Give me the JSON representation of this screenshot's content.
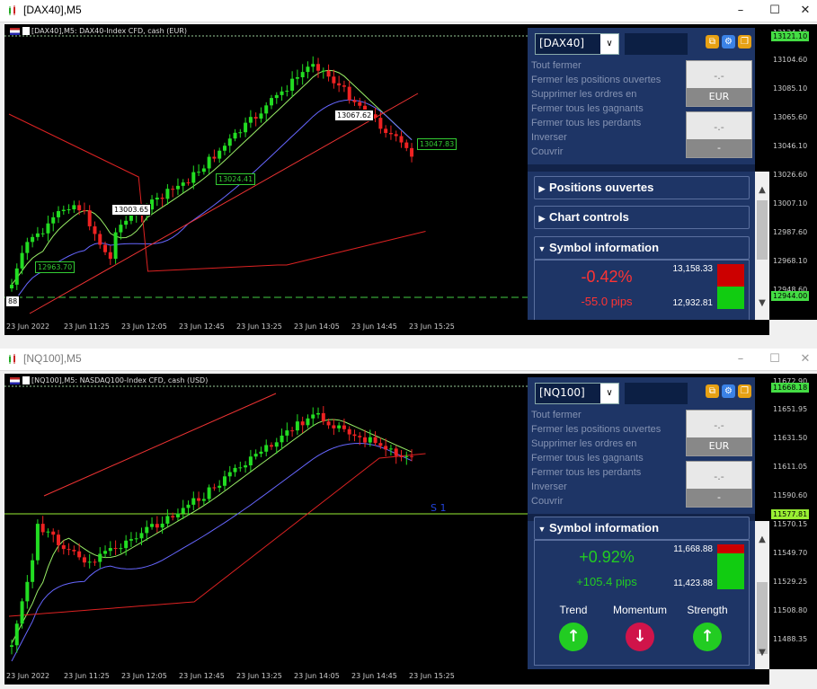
{
  "windows": [
    {
      "id": "dax",
      "title": "[DAX40],M5",
      "active": true,
      "header": "[DAX40],M5: DAX40-Index CFD, cash (EUR)",
      "price_labels": [
        "13124.10",
        "13104.60",
        "13085.10",
        "13065.60",
        "13046.10",
        "13026.60",
        "13007.10",
        "12987.60",
        "12968.10",
        "12948.60"
      ],
      "price_tags": [
        {
          "text": "13121.10",
          "bg": "#4d4",
          "fg": "#000"
        },
        {
          "text": "12944.00",
          "bg": "#4d4",
          "fg": "#000"
        }
      ],
      "time_labels": [
        "23 Jun 2022",
        "23 Jun 11:25",
        "23 Jun 12:05",
        "23 Jun 12:45",
        "23 Jun 13:25",
        "23 Jun 14:05",
        "23 Jun 14:45",
        "23 Jun 15:25"
      ],
      "annotations": [
        {
          "text": "13067.62",
          "style": "white"
        },
        {
          "text": "13047.83",
          "style": "green"
        },
        {
          "text": "13024.41",
          "style": "green"
        },
        {
          "text": "13003.65",
          "style": "white"
        },
        {
          "text": "12963.70",
          "style": "green"
        },
        {
          "text": "88",
          "style": "white"
        }
      ],
      "panel": {
        "symbol": "[DAX40]",
        "menu": [
          "Tout fermer",
          "Fermer les positions ouvertes",
          "Supprimer les ordres en",
          "Fermer tous les gagnants",
          "Fermer tous les perdants",
          "Inverser",
          "Couvrir"
        ],
        "box1": {
          "value": "-.-",
          "label": "EUR"
        },
        "box2": {
          "value": "-.-",
          "label": "-"
        },
        "sections": [
          "Positions ouvertes",
          "Chart controls",
          "Symbol information"
        ],
        "symbol_info": {
          "pct": "-0.42%",
          "pips": "-55.0 pips",
          "high": "13,158.33",
          "low": "12,932.81",
          "color": "#e42"
        }
      }
    },
    {
      "id": "nq",
      "title": "[NQ100],M5",
      "active": false,
      "header": "[NQ100],M5: NASDAQ100-Index CFD, cash (USD)",
      "price_labels": [
        "11672.90",
        "11651.95",
        "11631.50",
        "11611.05",
        "11590.60",
        "11570.15",
        "11549.70",
        "11529.25",
        "11508.80",
        "11488.35"
      ],
      "price_tags": [
        {
          "text": "11668.18",
          "bg": "#4d4",
          "fg": "#000"
        },
        {
          "text": "11577.81",
          "bg": "#9e3",
          "fg": "#000"
        }
      ],
      "time_labels": [
        "23 Jun 2022",
        "23 Jun 11:25",
        "23 Jun 12:05",
        "23 Jun 12:45",
        "23 Jun 13:25",
        "23 Jun 14:05",
        "23 Jun 14:45",
        "23 Jun 15:25"
      ],
      "level_label": "S 1",
      "panel": {
        "symbol": "[NQ100]",
        "menu": [
          "Tout fermer",
          "Fermer les positions ouvertes",
          "Supprimer les ordres en",
          "Fermer tous les gagnants",
          "Fermer tous les perdants",
          "Inverser",
          "Couvrir"
        ],
        "box1": {
          "value": "-.-",
          "label": "EUR"
        },
        "box2": {
          "value": "-.-",
          "label": "-"
        },
        "sections": [
          "Symbol information"
        ],
        "symbol_info": {
          "pct": "+0.92%",
          "pips": "+105.4 pips",
          "high": "11,668.88",
          "low": "11,423.88",
          "color": "#2c2"
        },
        "indicators": [
          {
            "name": "Trend",
            "dir": "up",
            "color": "#2c2"
          },
          {
            "name": "Momentum",
            "dir": "down",
            "color": "#d0144a"
          },
          {
            "name": "Strength",
            "dir": "up",
            "color": "#2c2"
          }
        ]
      }
    }
  ],
  "icons": {
    "minimize": "minimize-icon",
    "maximize": "maximize-icon",
    "close": "close-icon"
  }
}
